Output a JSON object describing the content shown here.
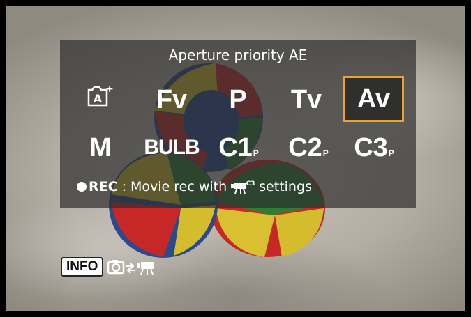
{
  "overlay": {
    "title": "Aperture priority AE",
    "modes_row1": [
      {
        "label": "A",
        "sup": "+",
        "icon": "scene-intelligent-auto-icon"
      },
      {
        "label": "Fv"
      },
      {
        "label": "P"
      },
      {
        "label": "Tv"
      },
      {
        "label": "Av",
        "selected": true
      }
    ],
    "modes_row2": [
      {
        "label": "M"
      },
      {
        "label": "BULB"
      },
      {
        "label": "C1",
        "sub": "P"
      },
      {
        "label": "C2",
        "sub": "P"
      },
      {
        "label": "C3",
        "sub": "P"
      }
    ],
    "rec_line": {
      "label": "REC",
      "text": ": Movie rec with",
      "icon_sup": "C3",
      "text_after": "settings"
    }
  },
  "footer": {
    "info_label": "INFO"
  },
  "colors": {
    "selection": "#f0a030"
  }
}
